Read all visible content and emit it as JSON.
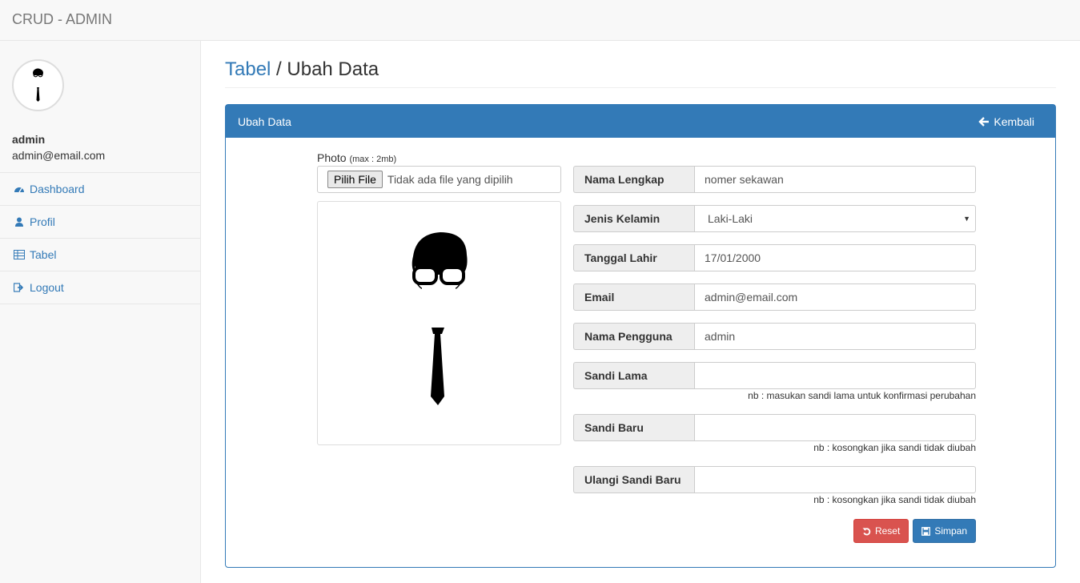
{
  "navbar": {
    "brand": "CRUD - ADMIN"
  },
  "sidebar": {
    "user": {
      "name": "admin",
      "email": "admin@email.com"
    },
    "items": [
      {
        "label": "Dashboard",
        "icon": "dashboard-icon"
      },
      {
        "label": "Profil",
        "icon": "user-icon"
      },
      {
        "label": "Tabel",
        "icon": "table-icon"
      },
      {
        "label": "Logout",
        "icon": "logout-icon"
      }
    ]
  },
  "page": {
    "breadcrumb_link": "Tabel",
    "separator": " / ",
    "title": "Ubah Data"
  },
  "panel": {
    "title": "Ubah Data",
    "back_label": "Kembali"
  },
  "photo": {
    "label": "Photo",
    "hint": "(max : 2mb)",
    "file_button": "Pilih File",
    "file_status": "Tidak ada file yang dipilih"
  },
  "fields": [
    {
      "label": "Nama Lengkap",
      "value": "nomer sekawan"
    },
    {
      "label": "Jenis Kelamin",
      "value": "Laki-Laki"
    },
    {
      "label": "Tanggal Lahir",
      "value": "17/01/2000"
    },
    {
      "label": "Email",
      "value": "admin@email.com"
    },
    {
      "label": "Nama Pengguna",
      "value": "admin"
    },
    {
      "label": "Sandi Lama",
      "value": "",
      "note": "nb : masukan sandi lama untuk konfirmasi perubahan"
    },
    {
      "label": "Sandi Baru",
      "value": "",
      "note": "nb : kosongkan jika sandi tidak diubah"
    },
    {
      "label": "Ulangi Sandi Baru",
      "value": "",
      "note": "nb : kosongkan jika sandi tidak diubah"
    }
  ],
  "buttons": {
    "reset": "Reset",
    "save": "Simpan"
  },
  "colors": {
    "primary": "#337ab7",
    "danger": "#d9534f"
  }
}
